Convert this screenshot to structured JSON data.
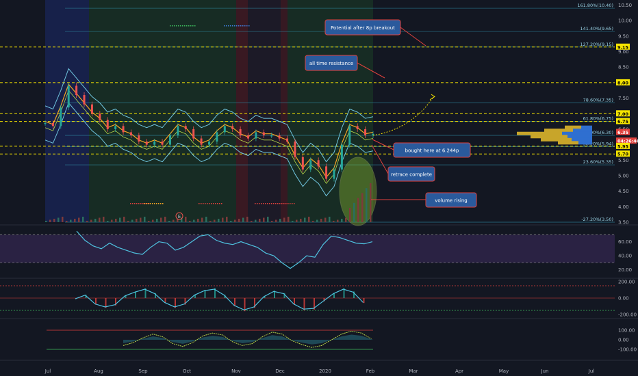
{
  "chart_data": {
    "type": "line",
    "x_labels": [
      "Jul",
      "Aug",
      "Sep",
      "Oct",
      "Nov",
      "Dec",
      "2020",
      "Feb",
      "Mar",
      "Apr",
      "May",
      "Jun",
      "Jul"
    ],
    "price_axis_ticks": [
      10.5,
      10.0,
      9.5,
      9.0,
      8.5,
      8.0,
      7.5,
      7.0,
      6.5,
      6.0,
      5.5,
      5.0,
      4.5,
      4.0,
      3.5
    ],
    "ylim": [
      3.5,
      10.6
    ],
    "price_series": [
      {
        "x": 0,
        "y": 6.7
      },
      {
        "x": 6,
        "y": 6.6
      },
      {
        "x": 12,
        "y": 7.2
      },
      {
        "x": 18,
        "y": 7.9
      },
      {
        "x": 24,
        "y": 7.6
      },
      {
        "x": 30,
        "y": 7.3
      },
      {
        "x": 36,
        "y": 7.0
      },
      {
        "x": 42,
        "y": 6.8
      },
      {
        "x": 48,
        "y": 6.5
      },
      {
        "x": 54,
        "y": 6.6
      },
      {
        "x": 60,
        "y": 6.4
      },
      {
        "x": 66,
        "y": 6.3
      },
      {
        "x": 72,
        "y": 6.1
      },
      {
        "x": 78,
        "y": 6.0
      },
      {
        "x": 84,
        "y": 6.1
      },
      {
        "x": 90,
        "y": 6.0
      },
      {
        "x": 96,
        "y": 6.3
      },
      {
        "x": 102,
        "y": 6.6
      },
      {
        "x": 108,
        "y": 6.5
      },
      {
        "x": 114,
        "y": 6.2
      },
      {
        "x": 120,
        "y": 6.0
      },
      {
        "x": 126,
        "y": 6.1
      },
      {
        "x": 132,
        "y": 6.4
      },
      {
        "x": 138,
        "y": 6.6
      },
      {
        "x": 144,
        "y": 6.5
      },
      {
        "x": 150,
        "y": 6.3
      },
      {
        "x": 156,
        "y": 6.2
      },
      {
        "x": 162,
        "y": 6.4
      },
      {
        "x": 168,
        "y": 6.3
      },
      {
        "x": 174,
        "y": 6.3
      },
      {
        "x": 180,
        "y": 6.2
      },
      {
        "x": 186,
        "y": 6.1
      },
      {
        "x": 192,
        "y": 5.6
      },
      {
        "x": 198,
        "y": 5.2
      },
      {
        "x": 204,
        "y": 5.5
      },
      {
        "x": 210,
        "y": 5.3
      },
      {
        "x": 216,
        "y": 4.9
      },
      {
        "x": 222,
        "y": 5.2
      },
      {
        "x": 228,
        "y": 6.0
      },
      {
        "x": 234,
        "y": 6.6
      },
      {
        "x": 240,
        "y": 6.5
      },
      {
        "x": 246,
        "y": 6.3
      },
      {
        "x": 252,
        "y": 6.35
      }
    ],
    "price_badges": [
      {
        "label": "9.15",
        "value": 9.15,
        "color": "#f5e400",
        "text_color": "#000000"
      },
      {
        "label": "8.00",
        "value": 8.0,
        "color": "#f5e400",
        "text_color": "#000000"
      },
      {
        "label": "7.00",
        "value": 7.0,
        "color": "#f5e400",
        "text_color": "#000000"
      },
      {
        "label": "6.75",
        "value": 6.75,
        "color": "#f5e400",
        "text_color": "#000000"
      },
      {
        "label": "6.35",
        "value": 6.4,
        "color": "#e0413d",
        "text_color": "#ffffff"
      },
      {
        "label": "04:26:46",
        "value": 6.12,
        "color": "#e0413d",
        "text_color": "#ffffff"
      },
      {
        "label": "5.95",
        "value": 5.95,
        "color": "#f5e400",
        "text_color": "#000000"
      },
      {
        "label": "5.70",
        "value": 5.7,
        "color": "#f5e400",
        "text_color": "#000000"
      }
    ],
    "dashed_levels": [
      9.15,
      8.0,
      7.0,
      6.75,
      5.95,
      5.7
    ],
    "fib_levels": [
      {
        "label": "161.80%(10.40)",
        "value": 10.4
      },
      {
        "label": "141.40%(9.65)",
        "value": 9.65
      },
      {
        "label": "127.20%(9.15)",
        "value": 9.15
      },
      {
        "label": "78.60%(7.35)",
        "value": 7.35
      },
      {
        "label": "61.80%(6.75)",
        "value": 6.75
      },
      {
        "label": "50.00%(6.30)",
        "value": 6.3
      },
      {
        "label": "38.20%(5.94)",
        "value": 5.94
      },
      {
        "label": "23.60%(5.35)",
        "value": 5.35
      },
      {
        "label": "-27.20%(3.50)",
        "value": 3.5
      }
    ],
    "annotations": [
      "Potential after 8p breakout",
      "all time resistance",
      "bought here at 6.244p",
      "retrace complete",
      "volume rising"
    ],
    "earnings_marker": "E",
    "rsi": {
      "ticks": [
        "60.00",
        "40.00",
        "20.00"
      ],
      "upper": 70,
      "lower": 30
    },
    "macd": {
      "ticks": [
        "200.00",
        "0.00",
        "-200.00"
      ]
    },
    "oscillator": {
      "ticks": [
        "100.00",
        "0.00",
        "-100.00"
      ]
    }
  }
}
